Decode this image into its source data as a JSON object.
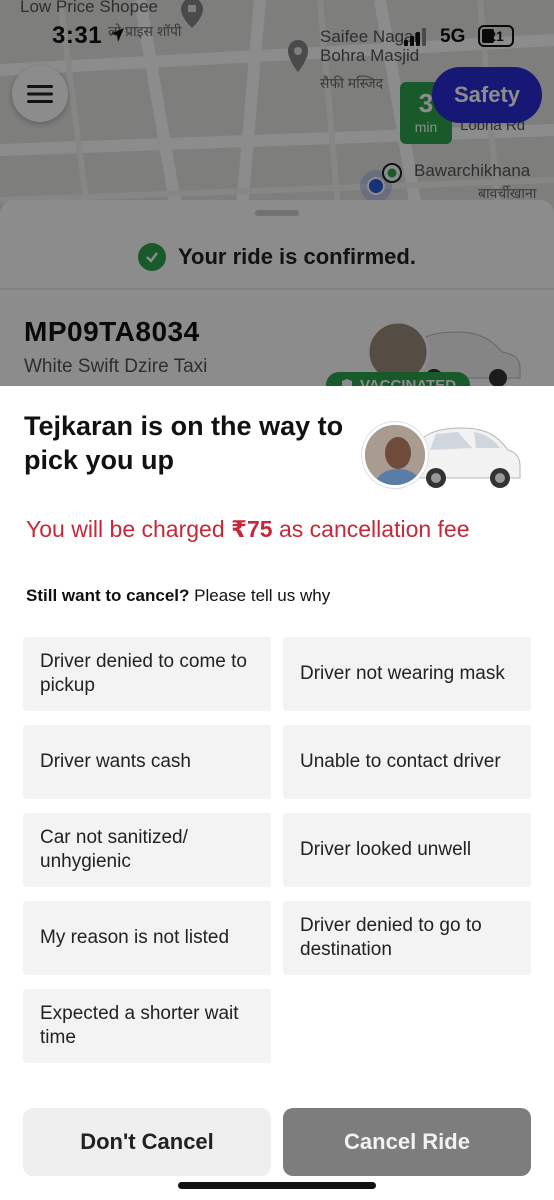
{
  "status_bar": {
    "time": "3:31",
    "network": "5G",
    "battery": "21"
  },
  "map": {
    "labels": {
      "shop": "Low Price Shopee",
      "shop_local": "लो प्राइस शॉपी",
      "mosque": "Saifee Nagar Bohra Masjid",
      "mosque_local": "सैफी मस्जिद",
      "road": "Lobha Rd",
      "restaurant": "Bawarchikhana",
      "restaurant_local": "बावर्चीखाना"
    },
    "eta_value": "3",
    "eta_unit": "min"
  },
  "safety_label": "Safety",
  "ride_card": {
    "status": "Your ride is confirmed.",
    "plate": "MP09TA8034",
    "car_model": "White Swift Dzire Taxi",
    "badge": "VACCINATED"
  },
  "sheet": {
    "title": "Tejkaran is on the way to pick you up",
    "fee_prefix": "You will be charged ",
    "fee_amount": "₹75",
    "fee_suffix": " as cancellation fee",
    "ask_bold": "Still want to cancel?",
    "ask_rest": " Please tell us why",
    "reasons": [
      "Driver denied to come to pickup",
      "Driver not wearing mask",
      "Driver wants cash",
      "Unable to contact driver",
      "Car not sanitized/ unhygienic",
      "Driver looked unwell",
      "My reason is not listed",
      "Driver denied to go to destination",
      "Expected a shorter wait time"
    ],
    "dont_cancel": "Don't Cancel",
    "cancel_ride": "Cancel Ride"
  },
  "colors": {
    "fee_red": "#c62839",
    "confirm_green": "#2ea44f",
    "safety_blue": "#2b2bd8",
    "cancel_disabled": "#7d7d7d"
  }
}
